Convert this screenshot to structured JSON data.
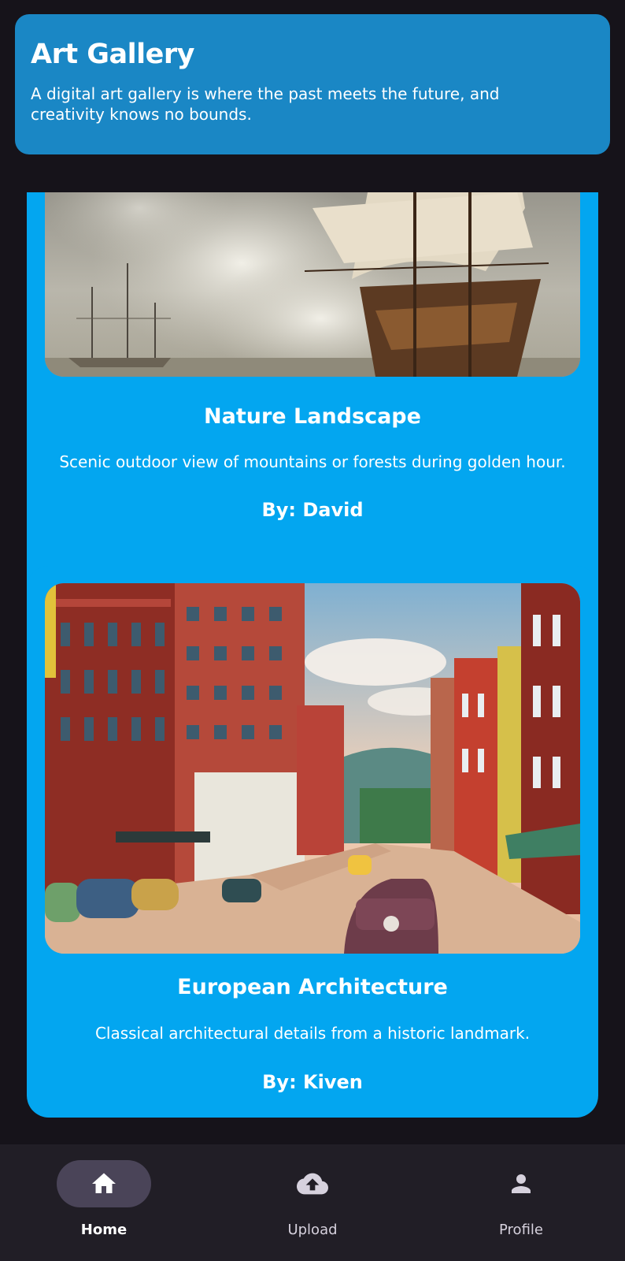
{
  "header": {
    "title": "Art Gallery",
    "subtitle": "A digital art gallery is where the past meets the future, and creativity knows no bounds."
  },
  "cards": [
    {
      "title": "Nature Landscape",
      "description": "Scenic outdoor view of mountains or forests during golden hour.",
      "author": "By: David",
      "image": "sailing-ships-painting"
    },
    {
      "title": "European Architecture",
      "description": "Classical architectural details from a historic landmark.",
      "author": "By: Kiven",
      "image": "vintage-street-postcard"
    }
  ],
  "bottom_nav": {
    "items": [
      {
        "label": "Home",
        "icon": "home-icon",
        "active": true
      },
      {
        "label": "Upload",
        "icon": "upload-cloud-icon",
        "active": false
      },
      {
        "label": "Profile",
        "icon": "person-icon",
        "active": false
      }
    ]
  },
  "colors": {
    "background": "#16131a",
    "header": "#1a87c5",
    "card": "#03a6f0",
    "nav_bar": "#211e26",
    "nav_active_pill": "#4a4458"
  }
}
